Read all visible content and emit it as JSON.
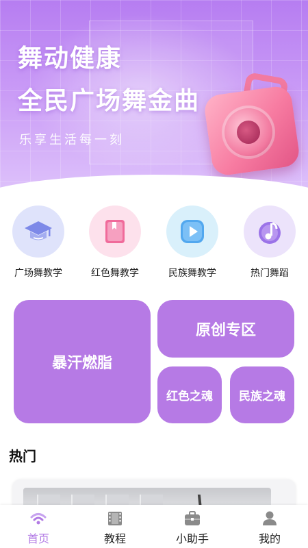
{
  "hero": {
    "title_line1": "舞动健康",
    "title_line2": "全民广场舞金曲",
    "subtitle": "乐享生活每一刻"
  },
  "categories": [
    {
      "label": "广场舞教学",
      "icon": "graduation-cap-icon",
      "bg": "#dfe3fb"
    },
    {
      "label": "红色舞教学",
      "icon": "book-icon",
      "bg": "#fde1ec"
    },
    {
      "label": "民族舞教学",
      "icon": "play-icon",
      "bg": "#d9f0fb"
    },
    {
      "label": "热门舞蹈",
      "icon": "music-note-icon",
      "bg": "#ece3fb"
    }
  ],
  "tiles": {
    "big": "暴汗燃脂",
    "original": "原创专区",
    "red": "红色之魂",
    "ethnic": "民族之魂"
  },
  "hot": {
    "title": "热门"
  },
  "tabbar": {
    "items": [
      {
        "label": "首页",
        "icon": "home-wifi-icon",
        "active": true
      },
      {
        "label": "教程",
        "icon": "film-icon",
        "active": false
      },
      {
        "label": "小助手",
        "icon": "briefcase-icon",
        "active": false
      },
      {
        "label": "我的",
        "icon": "person-icon",
        "active": false
      }
    ]
  },
  "colors": {
    "accent": "#b67ae5",
    "tab_active": "#b27ae4",
    "hero_gradient_top": "#b67df1"
  }
}
